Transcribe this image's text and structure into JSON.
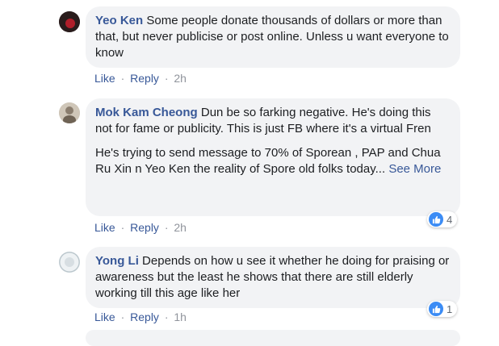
{
  "comments": [
    {
      "author": "Yeo Ken",
      "text": " Some people donate thousands of dollars or more than that, but never publicise or post online. Unless u want everyone to know",
      "like_label": "Like",
      "reply_label": "Reply",
      "separator": "·",
      "time": "2h"
    },
    {
      "author": "Mok Kam Cheong",
      "text": " Dun be so farking negative. He's doing this not for fame or publicity. This is just FB where it's a virtual Fren",
      "text2": "He's trying to send message to 70% of Sporean , PAP and Chua Ru Xin n Yeo Ken the reality of Spore old folks today",
      "ellipsis": "...",
      "see_more_label": "See More",
      "like_label": "Like",
      "reply_label": "Reply",
      "separator": "·",
      "time": "2h",
      "reaction_count": "4"
    },
    {
      "author": "Yong Li",
      "text": " Depends on how u see it whether he doing for praising or awareness but the least he shows that there are still elderly working till this age like her",
      "like_label": "Like",
      "reply_label": "Reply",
      "separator": "·",
      "time": "1h",
      "reaction_count": "1"
    }
  ],
  "colors": {
    "author_link": "#385898",
    "bubble_bg": "#f2f3f5",
    "like_blue": "#3b8cf5",
    "meta_gray": "#90949c"
  }
}
